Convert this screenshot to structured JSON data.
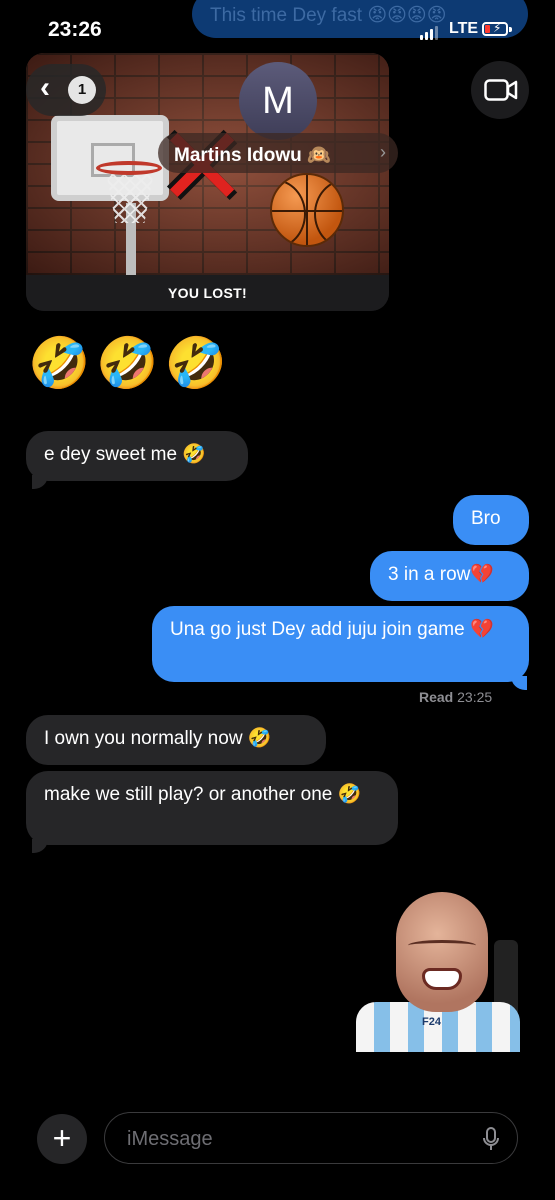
{
  "status_bar": {
    "time": "23:26",
    "network": "LTE"
  },
  "top_message_preview": "This time Dey fast 😡😡😡😡",
  "header": {
    "back_count": "1",
    "avatar_initial": "M",
    "contact_name": "Martins Idowu 🙉",
    "back_icon": "chevron-left-icon",
    "video_icon": "video-camera-icon"
  },
  "game_card": {
    "result_text": "YOU LOST!"
  },
  "messages": [
    {
      "direction": "in",
      "text": "🤣🤣🤣"
    },
    {
      "direction": "in",
      "text": "e dey sweet me 🤣"
    },
    {
      "direction": "out",
      "text": "Bro"
    },
    {
      "direction": "out",
      "text": "3 in a row💔"
    },
    {
      "direction": "out",
      "text": "Una go just Dey add juju join game 💔"
    },
    {
      "direction": "in",
      "text": "I own you normally now 🤣"
    },
    {
      "direction": "in",
      "text": "make we still play? or another one 🤣"
    }
  ],
  "read_receipt": {
    "label": "Read",
    "time": "23:25"
  },
  "sticker": {
    "shirt_text": "F24"
  },
  "composer": {
    "placeholder": "iMessage",
    "plus_label": "+"
  },
  "colors": {
    "outgoing_bubble": "#3a8ef5",
    "incoming_bubble": "#262628",
    "background": "#000000"
  }
}
